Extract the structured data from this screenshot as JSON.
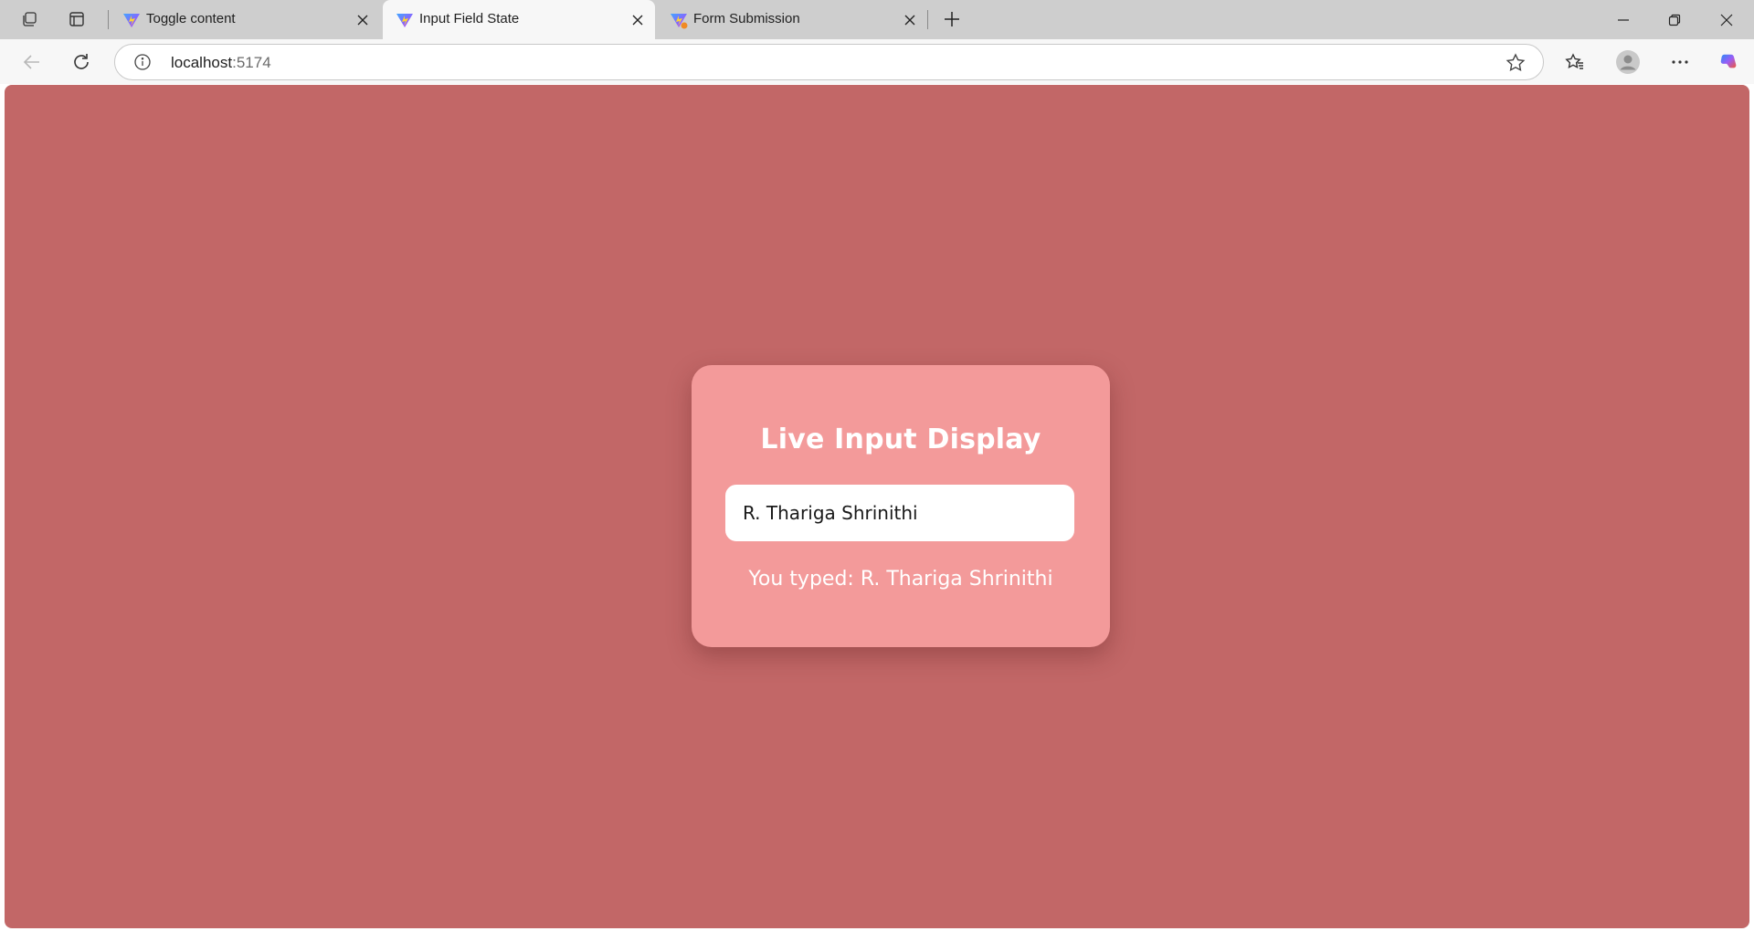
{
  "browser": {
    "tabs": [
      {
        "title": "Toggle content",
        "active": false
      },
      {
        "title": "Input Field State",
        "active": true
      },
      {
        "title": "Form Submission",
        "active": false
      }
    ],
    "address_host": "localhost",
    "address_port": ":5174"
  },
  "page": {
    "background": "#c26767",
    "card_color": "#f39a9a",
    "title": "Live Input Display",
    "input_value": "R. Thariga Shrinithi",
    "output_prefix": "You typed: ",
    "output_value": "R. Thariga Shrinithi"
  },
  "icons": {
    "workspaces": "workspaces-icon",
    "tab_actions": "tab-actions-icon",
    "favicon": "vite-favicon-icon",
    "close": "close-icon",
    "new_tab": "plus-icon",
    "minimize": "minimize-icon",
    "restore": "restore-icon",
    "window_close": "window-close-icon",
    "back": "back-arrow-icon",
    "refresh": "refresh-icon",
    "info": "info-icon",
    "favorite": "star-icon",
    "favorites": "favorites-icon",
    "profile": "profile-icon",
    "more": "more-icon",
    "copilot": "copilot-icon"
  }
}
